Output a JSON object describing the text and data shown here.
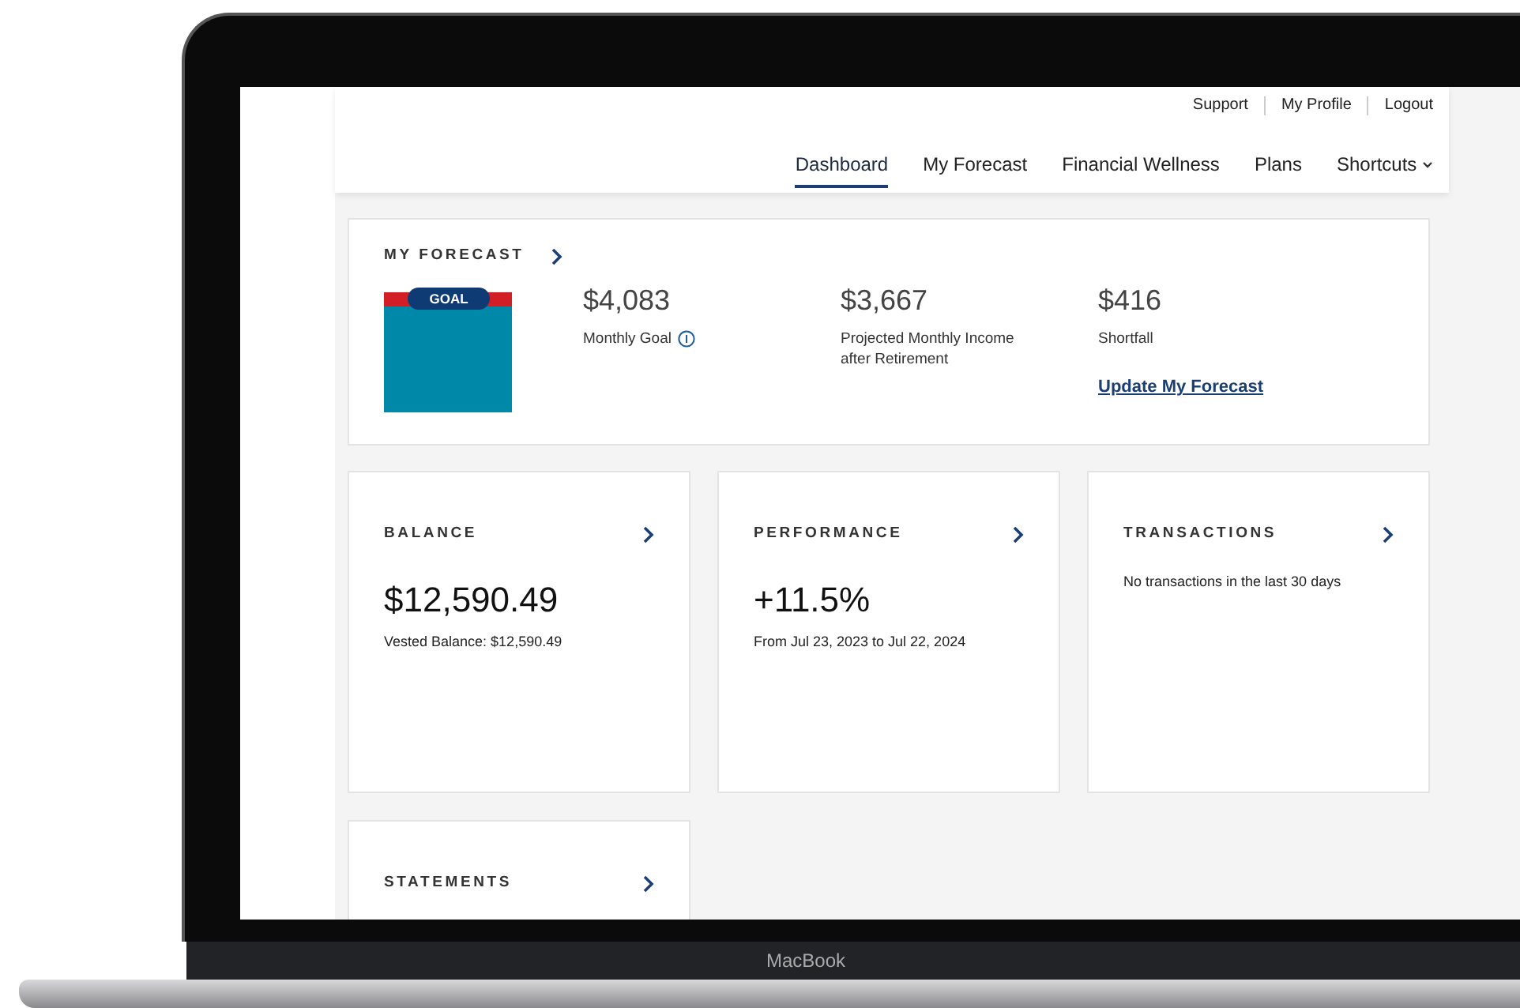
{
  "utility_links": [
    "Support",
    "My Profile",
    "Logout"
  ],
  "nav": [
    {
      "label": "Dashboard",
      "selected": true,
      "kind": "link"
    },
    {
      "label": "My Forecast",
      "selected": false,
      "kind": "link"
    },
    {
      "label": "Financial Wellness",
      "selected": false,
      "kind": "link"
    },
    {
      "label": "Plans",
      "selected": false,
      "kind": "link"
    },
    {
      "label": "Shortcuts",
      "selected": false,
      "kind": "dropdown"
    }
  ],
  "forecast": {
    "title": "MY FORECAST",
    "goal_badge": "GOAL",
    "metrics": [
      {
        "value": "$4,083",
        "label": "Monthly Goal",
        "info": true
      },
      {
        "value": "$3,667",
        "label": "Projected Monthly Income after Retirement",
        "info": false
      },
      {
        "value": "$416",
        "label": "Shortfall",
        "info": false
      }
    ],
    "link": "Update My Forecast"
  },
  "cards": [
    {
      "title": "BALANCE",
      "value": "$12,590.49",
      "note": "Vested Balance: $12,590.49"
    },
    {
      "title": "PERFORMANCE",
      "value": "+11.5%",
      "note": "From Jul 23, 2023 to Jul 22, 2024"
    },
    {
      "title": "TRANSACTIONS",
      "message": "No transactions in the last 30 days"
    },
    {
      "title": "STATEMENTS"
    }
  ],
  "device": {
    "label": "MacBook"
  }
}
